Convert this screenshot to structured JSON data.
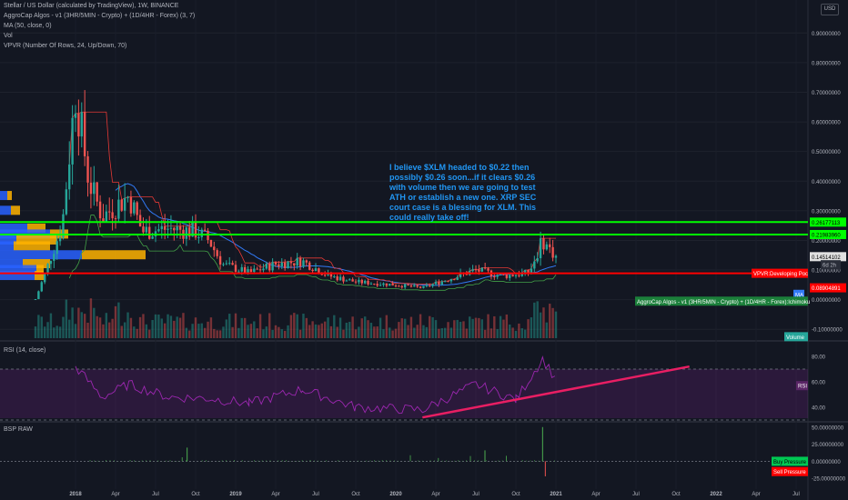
{
  "legend": {
    "title": "Stellar / US Dollar (calculated by TradingView), 1W, BINANCE",
    "algo": "AggroCap Algos - v1 (3HR/5MIN - Crypto) + (1D/4HR - Forex) (3, 7)",
    "ma": "MA (50, close, 0)",
    "vol": "Vol",
    "vpvr": "VPVR (Number Of Rows, 24, Up/Down, 70)",
    "currency": "USD"
  },
  "annotation": {
    "lines": [
      "I believe $XLM headed to $0.22 then",
      "possibly $0.26 soon...if it clears $0.26",
      "with volume then we are going to test",
      "ATH or establish a new one.  XRP SEC",
      "court case is a blessing for XLM.  This",
      "could really take off!"
    ]
  },
  "price_labels": {
    "green_top": "0.26177113",
    "green_mid": "0.21983960",
    "current": "0.14514102",
    "countdown": "6d 2h",
    "red_line": "0.08904891",
    "vpvr_tag": "VPVR:Developing Poc",
    "algo_tag": "AggroCap Algos - v1 (3HR/5MIN - Crypto) + (1D/4HR - Forex):Ichimoku",
    "ma_tag": "MA",
    "vol_tag": "Volume"
  },
  "rsi": {
    "label": "RSI (14, close)",
    "tag": "RSI",
    "ticks": [
      "80.00",
      "60.00",
      "40.00"
    ]
  },
  "bsp": {
    "label": "BSP RAW",
    "ticks": [
      "50.00000000",
      "25.00000000",
      "0.00000000",
      "-25.00000000"
    ],
    "buy_tag": "Buy Pressure",
    "sell_tag": "Sell Pressure"
  },
  "colors": {
    "background": "#131722",
    "up": "#26a69a",
    "down": "#ef5350",
    "green_line": "#00ff00",
    "red_line": "#ff0000",
    "rsi": "#9c27b0",
    "trend": "#e91e63",
    "annotation": "#2196f3",
    "vpvr_up": "#2962ff",
    "vpvr_down": "#ffb300"
  },
  "chart_data": [
    {
      "type": "candlestick",
      "title": "Stellar / US Dollar, 1W, BINANCE",
      "ylabel": "USD",
      "ylim": [
        -0.13,
        0.95
      ],
      "y_ticks": [
        "0.90000000",
        "0.80000000",
        "0.70000000",
        "0.60000000",
        "0.50000000",
        "0.40000000",
        "0.30000000",
        "0.20000000",
        "0.10000000",
        "0.00000000",
        "-0.10000000"
      ],
      "x_ticks": [
        "2018",
        "Apr",
        "Jul",
        "Oct",
        "2019",
        "Apr",
        "Jul",
        "Oct",
        "2020",
        "Apr",
        "Jul",
        "Oct",
        "2021",
        "Apr",
        "Jul",
        "Oct",
        "2022",
        "Apr",
        "Jul"
      ],
      "horizontal_lines": [
        {
          "value": 0.26177113,
          "color": "#00ff00"
        },
        {
          "value": 0.2198396,
          "color": "#00ff00"
        },
        {
          "value": 0.08904891,
          "color": "#ff0000"
        }
      ],
      "approx_close_path": [
        {
          "date": "2017-10",
          "close": 0.0
        },
        {
          "date": "2017-12",
          "close": 0.25
        },
        {
          "date": "2018-01",
          "close": 0.7
        },
        {
          "date": "2018-02",
          "close": 0.4
        },
        {
          "date": "2018-03",
          "close": 0.28
        },
        {
          "date": "2018-05",
          "close": 0.35
        },
        {
          "date": "2018-06",
          "close": 0.23
        },
        {
          "date": "2018-08",
          "close": 0.24
        },
        {
          "date": "2018-10",
          "close": 0.23
        },
        {
          "date": "2018-11",
          "close": 0.2
        },
        {
          "date": "2018-12",
          "close": 0.12
        },
        {
          "date": "2019-02",
          "close": 0.09
        },
        {
          "date": "2019-04",
          "close": 0.12
        },
        {
          "date": "2019-06",
          "close": 0.13
        },
        {
          "date": "2019-08",
          "close": 0.08
        },
        {
          "date": "2019-10",
          "close": 0.06
        },
        {
          "date": "2020-01",
          "close": 0.05
        },
        {
          "date": "2020-03",
          "close": 0.04
        },
        {
          "date": "2020-05",
          "close": 0.07
        },
        {
          "date": "2020-07",
          "close": 0.1
        },
        {
          "date": "2020-09",
          "close": 0.08
        },
        {
          "date": "2020-11",
          "close": 0.09
        },
        {
          "date": "2020-12",
          "close": 0.2
        },
        {
          "date": "2021-01",
          "close": 0.145
        }
      ]
    },
    {
      "type": "line",
      "title": "RSI (14, close)",
      "ylim": [
        30,
        90
      ],
      "y_ticks": [
        "80.00",
        "60.00",
        "40.00"
      ],
      "approx_path": [
        {
          "date": "2018-01",
          "value": 72
        },
        {
          "date": "2018-03",
          "value": 48
        },
        {
          "date": "2018-05",
          "value": 58
        },
        {
          "date": "2018-08",
          "value": 48
        },
        {
          "date": "2018-11",
          "value": 47
        },
        {
          "date": "2019-02",
          "value": 43
        },
        {
          "date": "2019-06",
          "value": 54
        },
        {
          "date": "2019-10",
          "value": 40
        },
        {
          "date": "2020-03",
          "value": 38
        },
        {
          "date": "2020-07",
          "value": 58
        },
        {
          "date": "2020-10",
          "value": 46
        },
        {
          "date": "2020-12",
          "value": 78
        },
        {
          "date": "2021-01",
          "value": 62
        }
      ]
    },
    {
      "type": "bar",
      "title": "BSP RAW",
      "ylim": [
        -30,
        55
      ],
      "y_ticks": [
        "50.00000000",
        "25.00000000",
        "0.00000000",
        "-25.00000000"
      ]
    }
  ]
}
